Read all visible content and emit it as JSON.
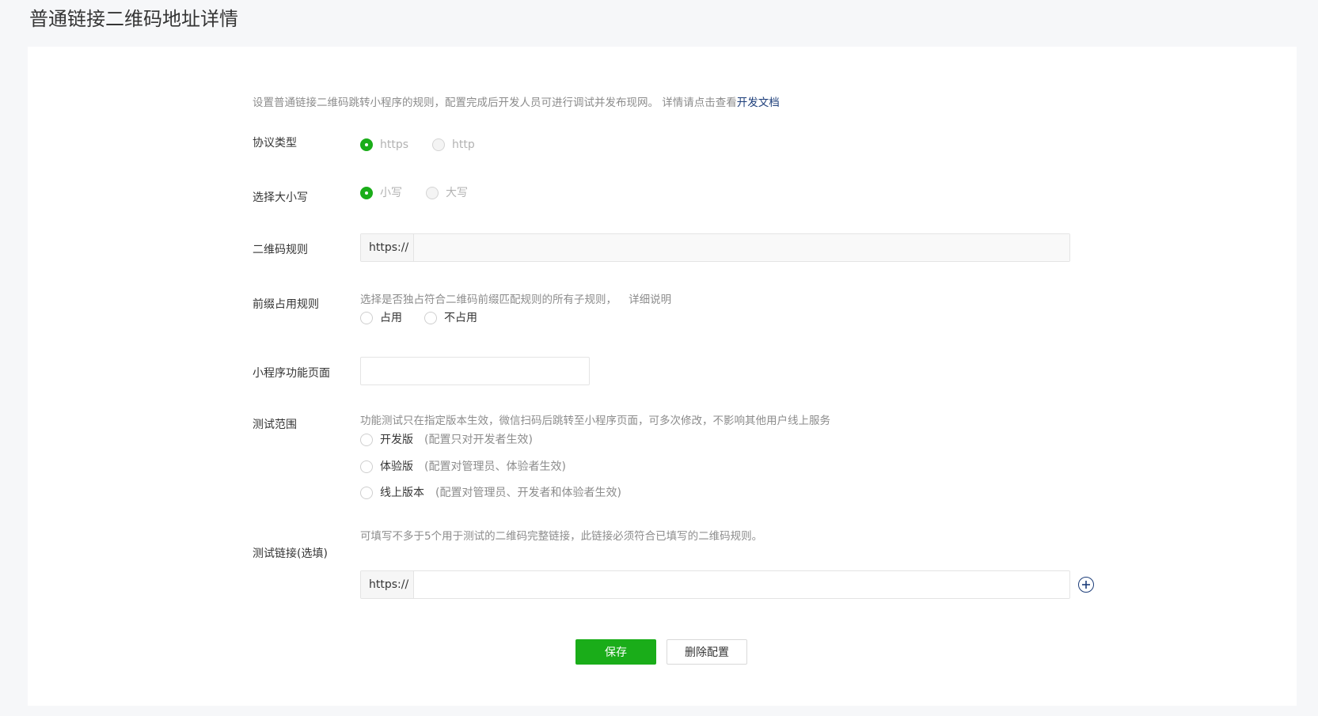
{
  "page": {
    "title": "普通链接二维码地址详情"
  },
  "description": {
    "text": "设置普通链接二维码跳转小程序的规则，配置完成后开发人员可进行调试并发布现网。 详情请点击查看",
    "link": "开发文档"
  },
  "protocol": {
    "label": "协议类型",
    "options": [
      "https",
      "http"
    ],
    "selected": "https"
  },
  "case": {
    "label": "选择大小写",
    "options": [
      "小写",
      "大写"
    ],
    "selected": "小写"
  },
  "qr_rule": {
    "label": "二维码规则",
    "prefix": "https://",
    "value": ""
  },
  "prefix_rule": {
    "label": "前缀占用规则",
    "hint": "选择是否独占符合二维码前缀匹配规则的所有子规则，",
    "hint_link": "详细说明",
    "options": [
      "占用",
      "不占用"
    ]
  },
  "page_path": {
    "label": "小程序功能页面",
    "value": ""
  },
  "test_scope": {
    "label": "测试范围",
    "hint": "功能测试只在指定版本生效，微信扫码后跳转至小程序页面，可多次修改，不影响其他用户线上服务",
    "options": [
      {
        "name": "开发版",
        "note": "(配置只对开发者生效)"
      },
      {
        "name": "体验版",
        "note": "(配置对管理员、体验者生效)"
      },
      {
        "name": "线上版本",
        "note": "(配置对管理员、开发者和体验者生效)"
      }
    ]
  },
  "test_link": {
    "label": "测试链接(选填)",
    "hint": "可填写不多于5个用于测试的二维码完整链接，此链接必须符合已填写的二维码规则。",
    "prefix": "https://",
    "value": ""
  },
  "actions": {
    "save": "保存",
    "delete": "删除配置"
  },
  "colors": {
    "primary": "#1aad19",
    "link": "#1d3e7a"
  }
}
